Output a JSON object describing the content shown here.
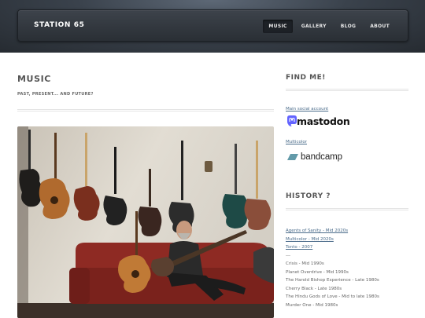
{
  "site": {
    "title": "STATION 65"
  },
  "nav": {
    "items": [
      {
        "label": "MUSIC",
        "active": true
      },
      {
        "label": "GALLERY",
        "active": false
      },
      {
        "label": "BLOG",
        "active": false
      },
      {
        "label": "ABOUT",
        "active": false
      }
    ]
  },
  "main": {
    "title": "MUSIC",
    "subtitle": "PAST, PRESENT... AND FUTURE?",
    "photo": {
      "icon": "guitar-wall-photo"
    }
  },
  "sidebar": {
    "find_title": "FIND ME!",
    "main_account_label": "Main social account",
    "mastodon_wordmark": "mastodon",
    "multicolor_label": "Multicolor",
    "bandcamp_wordmark": "bandcamp",
    "history_title": "HISTORY ?",
    "history": [
      {
        "text": "Agents of Sanity - Mid 2020s",
        "link": true
      },
      {
        "text": "Multicolor - Mid 2020s",
        "link": true
      },
      {
        "text": "Tonto - 2007",
        "link": true
      },
      {
        "text": "---",
        "link": false
      },
      {
        "text": "Crisis - Mid 1990s",
        "link": false
      },
      {
        "text": "Planet Overdrive - Mid 1990s",
        "link": false
      },
      {
        "text": "The Harold Bishop Experience - Late 1980s",
        "link": false
      },
      {
        "text": "Cherry Black - Late 1980s",
        "link": false
      },
      {
        "text": "The Hindu Gods of Love - Mid to late 1980s",
        "link": false
      },
      {
        "text": "Murder One - Mid 1980s",
        "link": false
      }
    ]
  },
  "colors": {
    "link": "#4a6b8a",
    "header_dark": "#2a2f35",
    "mastodon_purple": "#6364ff",
    "bandcamp_teal": "#629aa9"
  }
}
